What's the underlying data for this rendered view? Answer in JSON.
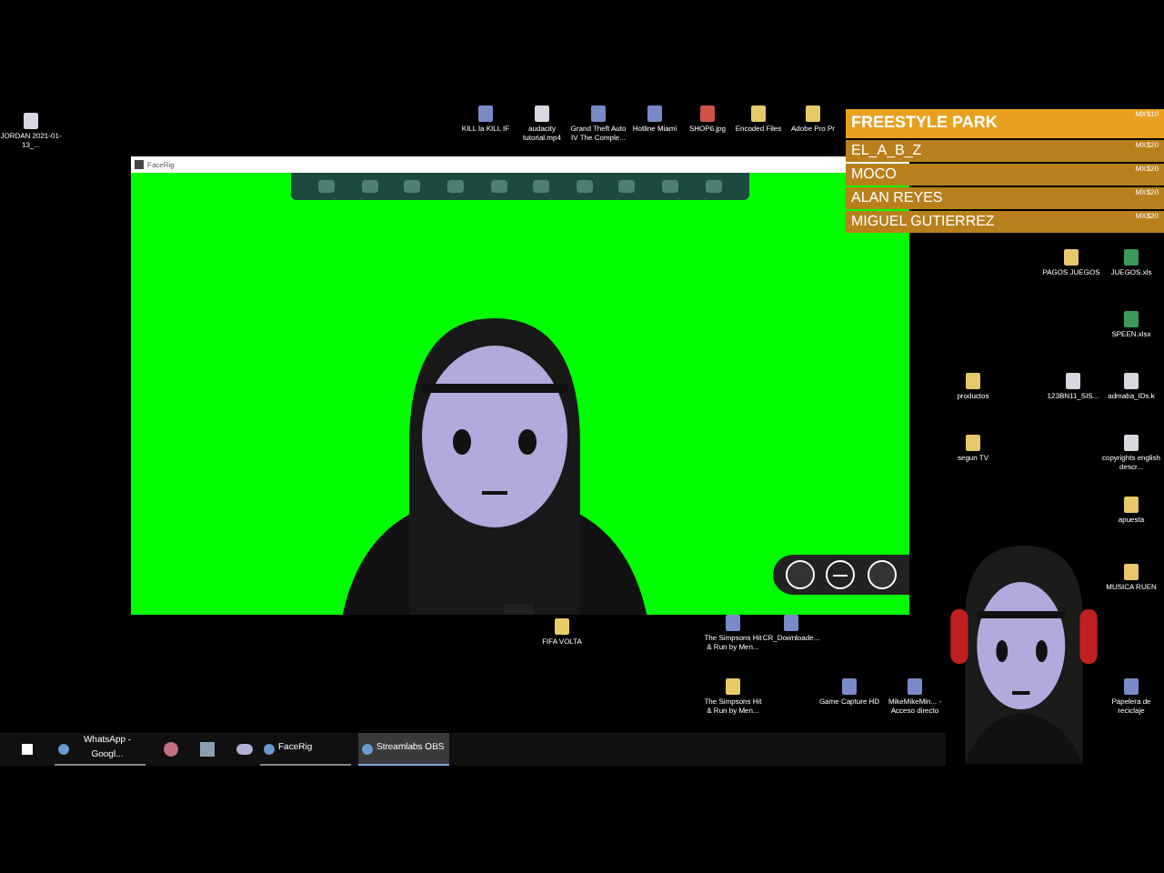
{
  "desktop_icons": [
    {
      "label": "JORDAN 2021-01-13_...",
      "kind": "file"
    },
    {
      "label": "KILL la KILL IF",
      "kind": "app"
    },
    {
      "label": "audacity tutorial.mp4",
      "kind": "file"
    },
    {
      "label": "Grand Theft Auto IV The Comple...",
      "kind": "app"
    },
    {
      "label": "Hotline Miami",
      "kind": "app"
    },
    {
      "label": "SHOP6.jpg",
      "kind": "image"
    },
    {
      "label": "Encoded Files",
      "kind": "folder"
    },
    {
      "label": "Adobe Pro Pr",
      "kind": "folder"
    },
    {
      "label": "PAGOS JUEGOS",
      "kind": "folder"
    },
    {
      "label": "JUEGOS.xls",
      "kind": "sheet"
    },
    {
      "label": "SPEEN.xlsx",
      "kind": "sheet"
    },
    {
      "label": "productos",
      "kind": "folder"
    },
    {
      "label": "123BN11_SIS...",
      "kind": "file"
    },
    {
      "label": "admaba_IDs.k",
      "kind": "file"
    },
    {
      "label": "segun TV",
      "kind": "folder"
    },
    {
      "label": "copyrights english descr...",
      "kind": "file"
    },
    {
      "label": "apuesta",
      "kind": "folder"
    },
    {
      "label": "MUSICA RUEN",
      "kind": "folder"
    },
    {
      "label": "FIFA VOLTA",
      "kind": "folder"
    },
    {
      "label": "The Simpsons Hit & Run by Men...",
      "kind": "app"
    },
    {
      "label": "CR_Downloade...",
      "kind": "app"
    },
    {
      "label": "The Simpsons Hit & Run by Men...",
      "kind": "folder"
    },
    {
      "label": "Game Capture HD",
      "kind": "app"
    },
    {
      "label": "MikeMikeMin... - Acceso directo",
      "kind": "app"
    },
    {
      "label": "Papelera de reciclaje",
      "kind": "app"
    }
  ],
  "window": {
    "title": "FaceRig"
  },
  "leaderboard": [
    {
      "name": "FREESTYLE PARK",
      "amount": "MX$10",
      "selected": true
    },
    {
      "name": "EL_A_B_Z",
      "amount": "MX$20",
      "selected": false
    },
    {
      "name": "MOCO",
      "amount": "MX$20",
      "selected": false
    },
    {
      "name": "ALAN REYES",
      "amount": "MX$20",
      "selected": false
    },
    {
      "name": "MIGUEL GUTIERREZ",
      "amount": "MX$20",
      "selected": false
    }
  ],
  "taskbar": [
    {
      "label": "WhatsApp - Googl...",
      "active": false
    },
    {
      "label": "FaceRig",
      "active": false
    },
    {
      "label": "Streamlabs OBS",
      "active": true
    }
  ]
}
